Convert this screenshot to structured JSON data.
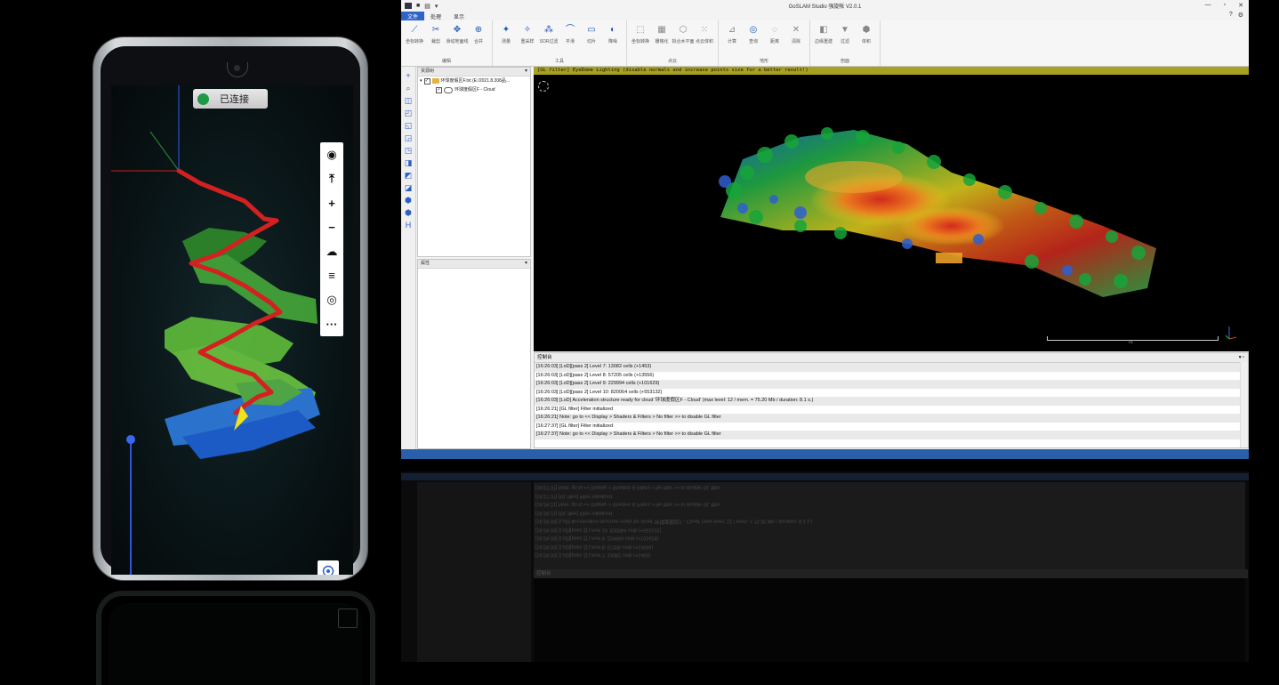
{
  "phone": {
    "status_text": "已连接",
    "status_color": "#1e9a45",
    "toolbar_icons": [
      "eye-icon",
      "fit-height-icon",
      "zoom-in-icon",
      "zoom-out-icon",
      "cloud-icon",
      "align-icon",
      "target-icon",
      "more-icon"
    ],
    "toolbar_glyphs": [
      "◉",
      "⤒",
      "+",
      "−",
      "☁",
      "≡",
      "◎",
      "···"
    ]
  },
  "app": {
    "title": "GoSLAM Studio 强旋帐  V2.0.1",
    "quick_icons": [
      "■",
      "▤",
      "▾"
    ],
    "window_controls": [
      "—",
      "▫",
      "✕"
    ],
    "menu": [
      "文件",
      "处理",
      "显示"
    ],
    "menu_right": [
      "?",
      "⚙"
    ],
    "ribbon_groups": [
      {
        "label": "编辑",
        "buttons": [
          {
            "icon": "⟋",
            "label": "坐标转换"
          },
          {
            "icon": "✂",
            "label": "裁剪"
          },
          {
            "icon": "✥",
            "label": "滑动地面线"
          },
          {
            "icon": "⊕",
            "label": "合并"
          }
        ]
      },
      {
        "label": "工具",
        "buttons": [
          {
            "icon": "✦",
            "label": "测量"
          },
          {
            "icon": "✧",
            "label": "重采样"
          },
          {
            "icon": "⁂",
            "label": "SOR过滤"
          },
          {
            "icon": "⌒",
            "label": "平滑"
          },
          {
            "icon": "▭",
            "label": "切片"
          },
          {
            "icon": "◐",
            "label": "降噪"
          }
        ]
      },
      {
        "label": "点云",
        "buttons": [
          {
            "icon": "⬚",
            "label": "坐标转换"
          },
          {
            "icon": "▦",
            "label": "栅格化"
          },
          {
            "icon": "⬡",
            "label": "拟合水平面"
          },
          {
            "icon": "⁙",
            "label": "点云体积"
          }
        ]
      },
      {
        "label": "地形",
        "buttons": [
          {
            "icon": "⊿",
            "label": "计算"
          },
          {
            "icon": "◎",
            "label": "查询"
          },
          {
            "icon": "◌",
            "label": "距离"
          },
          {
            "icon": "✕",
            "label": "清除"
          }
        ]
      },
      {
        "label": "剖面",
        "buttons": [
          {
            "icon": "◧",
            "label": "边缘重建"
          },
          {
            "icon": "▼",
            "label": "过滤"
          },
          {
            "icon": "⬢",
            "label": "体积"
          }
        ]
      }
    ],
    "left_tools": [
      "+",
      "⌕",
      "◫",
      "◰",
      "◱",
      "◲",
      "◳",
      "◨",
      "◩",
      "◪",
      "⬢",
      "⬢",
      "H"
    ],
    "db_tree": {
      "header": "资源树",
      "root_label": "环球度假区F.txt (E:/2021.8.308品...",
      "child_label": "环球度假区F - Cloud"
    },
    "properties": {
      "header": "属性"
    },
    "viewport": {
      "gl_filter_text": "[GL filter] EyeDome Lighting (disable normals and increase points size for a better result!)",
      "scale_label": "75"
    },
    "console": {
      "header": "控制台",
      "lines": [
        "[16:26:03] [LoD][pass 2] Level 7: 13082 cells (+1453)",
        "[16:26:03] [LoD][pass 2] Level 8: 57205 cells (+13556)",
        "[16:26:03] [LoD][pass 2] Level 9: 229994 cells (+101629)",
        "[16:26:03] [LoD][pass 2] Level 10: 820064 cells (+553132)",
        "[16:26:03] [LoD] Acceleration structure ready for cloud '环球度假区F - Cloud' (max level: 12 / mem. = 75.20 Mb / duration: 8.1 s.)",
        "[16:26:21] [GL filter] Filter initialized",
        "[16:26:21] Note: go to << Display > Shaders & Filters > No filter >> to disable GL filter",
        "[16:27:37] [GL filter] Filter initialized",
        "[16:27:37] Note: go to << Display > Shaders & Filters > No filter >> to disable GL filter"
      ]
    }
  },
  "colors": {
    "accent": "#2e63c8",
    "taskbar": "#2a5faa",
    "gl_bar": "#a8a020",
    "trajectory": "#d42020"
  }
}
